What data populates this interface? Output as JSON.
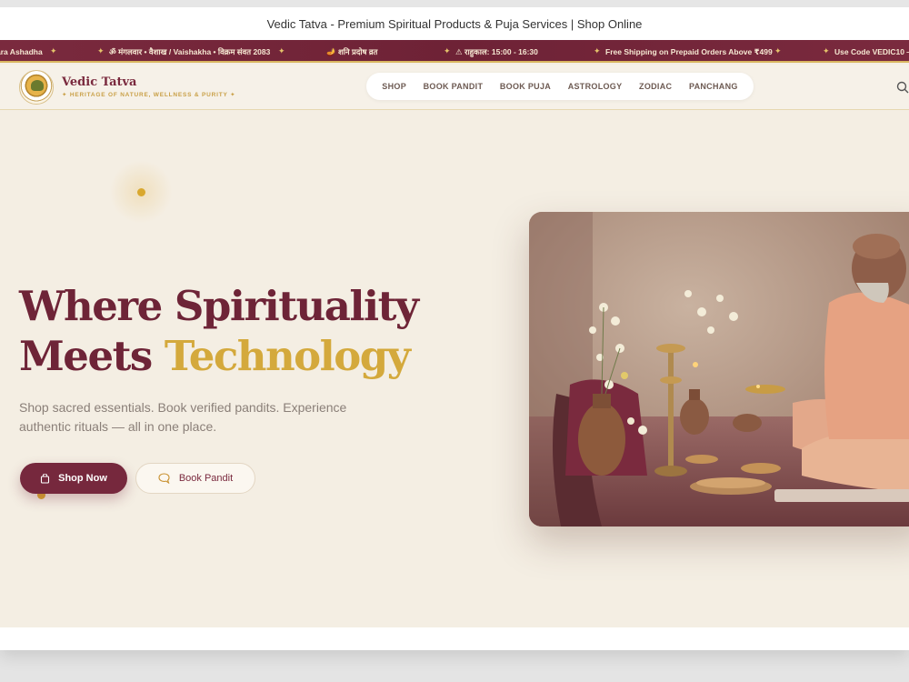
{
  "window": {
    "title": "Vedic Tatva - Premium Spiritual Products & Puja Services | Shop Online"
  },
  "ticker": {
    "items": [
      "ara Ashadha",
      "ॐ मंगलवार • वैशाख / Vaishakha • विक्रम संवत 2083",
      "🪔 शनि प्रदोष व्रत",
      "⚠ राहुकाल: 15:00 - 16:30",
      "Free Shipping on Prepaid Orders Above ₹499",
      "Use Code VEDIC10 —"
    ]
  },
  "header": {
    "brand_name": "Vedic Tatva",
    "tagline": "✦ HERITAGE OF NATURE, WELLNESS & PURITY ✦",
    "nav": [
      "SHOP",
      "BOOK PANDIT",
      "BOOK PUJA",
      "ASTROLOGY",
      "ZODIAC",
      "PANCHANG"
    ]
  },
  "hero": {
    "headline_line1": "Where Spirituality",
    "headline_line2_plain": "Meets ",
    "headline_line2_accent": "Technology",
    "subtext": "Shop sacred essentials. Book verified pandits. Experience authentic rituals — all in one place.",
    "primary_button": "Shop Now",
    "secondary_button": "Book Pandit"
  },
  "colors": {
    "brand": "#76283d",
    "accent": "#d4a93c",
    "background": "#f4eee3"
  },
  "icons": {
    "cart": "shopping-bag-icon",
    "chat": "chat-icon",
    "search": "search-icon"
  }
}
